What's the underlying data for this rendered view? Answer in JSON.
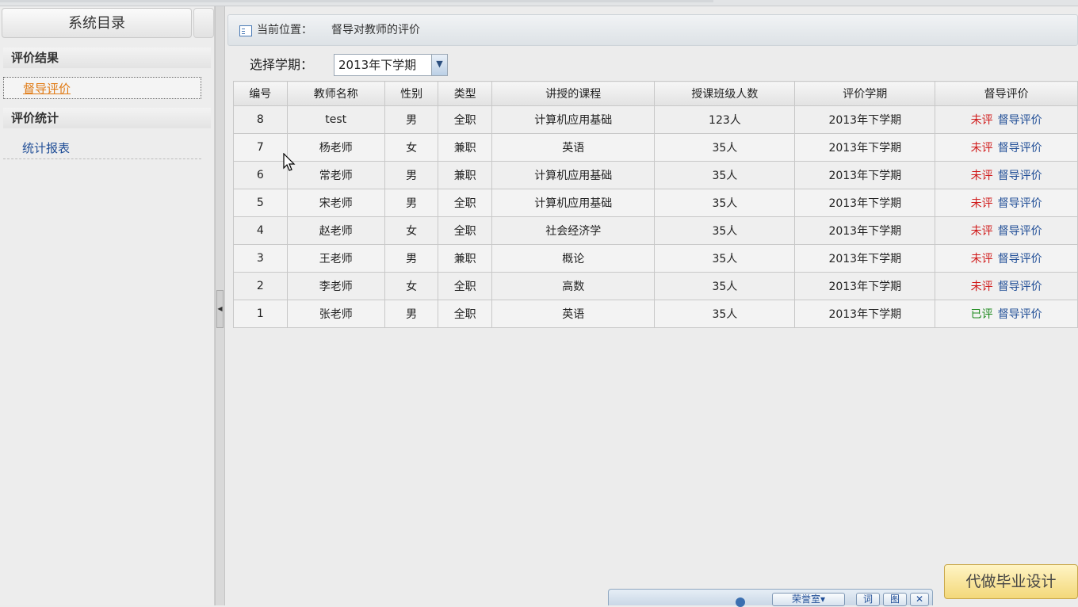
{
  "sidebar": {
    "title": "系统目录",
    "sections": [
      {
        "label": "评价结果",
        "items": [
          {
            "label": "督导评价",
            "active": true
          }
        ]
      },
      {
        "label": "评价统计",
        "items": [
          {
            "label": "统计报表",
            "active": false
          }
        ]
      }
    ]
  },
  "breadcrumb": {
    "label": "当前位置：",
    "value": "督导对教师的评价"
  },
  "term_filter": {
    "label": "选择学期：",
    "selected": "2013年下学期"
  },
  "table": {
    "columns": [
      "编号",
      "教师名称",
      "性别",
      "类型",
      "讲授的课程",
      "授课班级人数",
      "评价学期",
      "督导评价"
    ],
    "rows": [
      {
        "id": "8",
        "name": "test",
        "gender": "男",
        "type": "全职",
        "course": "计算机应用基础",
        "class_size": "123人",
        "term": "2013年下学期",
        "status": "未评",
        "rated": false,
        "action": "督导评价"
      },
      {
        "id": "7",
        "name": "杨老师",
        "gender": "女",
        "type": "兼职",
        "course": "英语",
        "class_size": "35人",
        "term": "2013年下学期",
        "status": "未评",
        "rated": false,
        "action": "督导评价"
      },
      {
        "id": "6",
        "name": "常老师",
        "gender": "男",
        "type": "兼职",
        "course": "计算机应用基础",
        "class_size": "35人",
        "term": "2013年下学期",
        "status": "未评",
        "rated": false,
        "action": "督导评价"
      },
      {
        "id": "5",
        "name": "宋老师",
        "gender": "男",
        "type": "全职",
        "course": "计算机应用基础",
        "class_size": "35人",
        "term": "2013年下学期",
        "status": "未评",
        "rated": false,
        "action": "督导评价"
      },
      {
        "id": "4",
        "name": "赵老师",
        "gender": "女",
        "type": "全职",
        "course": "社会经济学",
        "class_size": "35人",
        "term": "2013年下学期",
        "status": "未评",
        "rated": false,
        "action": "督导评价"
      },
      {
        "id": "3",
        "name": "王老师",
        "gender": "男",
        "type": "兼职",
        "course": "概论",
        "class_size": "35人",
        "term": "2013年下学期",
        "status": "未评",
        "rated": false,
        "action": "督导评价"
      },
      {
        "id": "2",
        "name": "李老师",
        "gender": "女",
        "type": "全职",
        "course": "高数",
        "class_size": "35人",
        "term": "2013年下学期",
        "status": "未评",
        "rated": false,
        "action": "督导评价"
      },
      {
        "id": "1",
        "name": "张老师",
        "gender": "男",
        "type": "全职",
        "course": "英语",
        "class_size": "35人",
        "term": "2013年下学期",
        "status": "已评",
        "rated": true,
        "action": "督导评价"
      }
    ]
  },
  "floating_toolbar": {
    "dropdown": "荣誉室▾",
    "btn1": "词",
    "btn2": "图",
    "close": "✕"
  },
  "ad_banner": "代做毕业设计",
  "colors": {
    "unrated": "#d01c1c",
    "rated": "#1e8a1e",
    "link": "#1f4d96",
    "active_nav": "#e07a14"
  }
}
